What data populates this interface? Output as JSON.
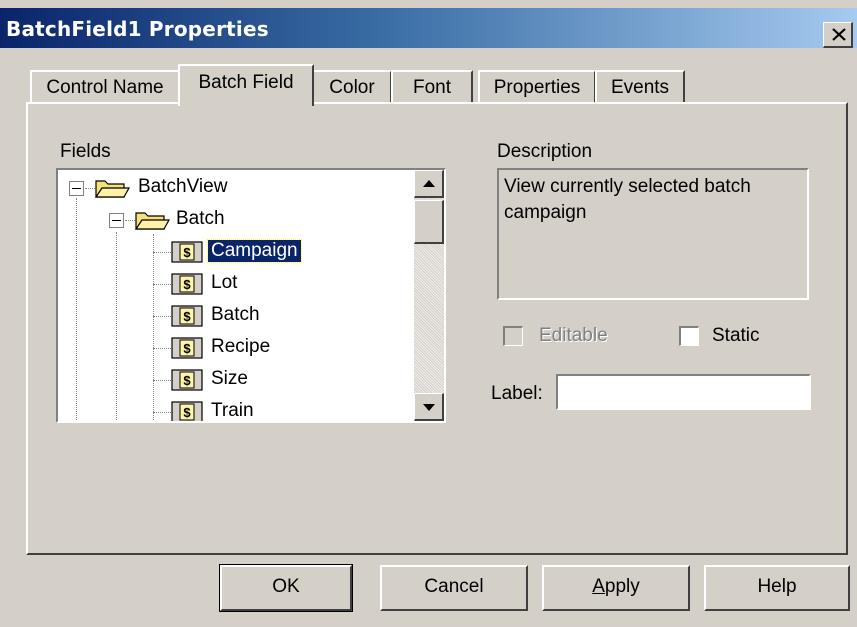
{
  "window": {
    "title": "BatchField1 Properties"
  },
  "tabs": [
    {
      "label": "Control Name"
    },
    {
      "label": "Batch Field"
    },
    {
      "label": "Color"
    },
    {
      "label": "Font"
    },
    {
      "label": "Properties"
    },
    {
      "label": "Events"
    }
  ],
  "active_tab": "Batch Field",
  "fields": {
    "label": "Fields",
    "tree": {
      "root": "BatchView",
      "group": "Batch",
      "items": [
        "Campaign",
        "Lot",
        "Batch",
        "Recipe",
        "Size",
        "Train"
      ],
      "selected": "Campaign"
    }
  },
  "description": {
    "label": "Description",
    "text": "View currently selected batch campaign"
  },
  "options": {
    "editable_label": "Editable",
    "editable_checked": false,
    "editable_enabled": false,
    "static_label": "Static",
    "static_checked": false
  },
  "label_field": {
    "label": "Label:",
    "value": ""
  },
  "buttons": {
    "ok": "OK",
    "cancel": "Cancel",
    "apply_prefix": "",
    "apply_underlined": "A",
    "apply_rest": "pply",
    "help": "Help"
  },
  "colors": {
    "title_bar_start": "#0a246a",
    "title_bar_end": "#a6caf0",
    "selection": "#0a246a",
    "dialog_face": "#d4d0c8"
  }
}
